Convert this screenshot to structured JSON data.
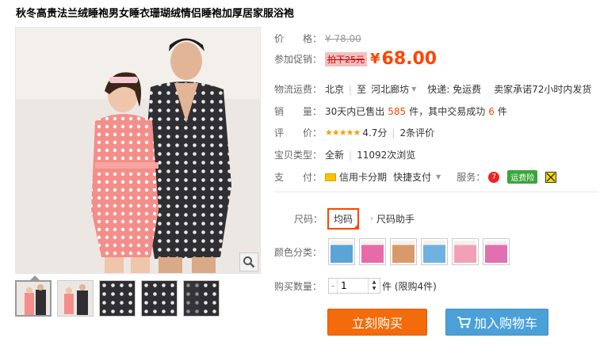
{
  "product": {
    "title": "秋冬高贵法兰绒睡袍男女睡衣珊瑚绒情侣睡袍加厚居家服浴袍"
  },
  "price": {
    "label": "价　　格：",
    "original": "¥ 78.00"
  },
  "promo": {
    "label": "参加促销：",
    "tag": "拍下25元",
    "currency": "¥",
    "amount": "68.00"
  },
  "shipping": {
    "label": "物流运费：",
    "from": "北京",
    "to_prefix": "至",
    "to": "河北廊坊",
    "express": "快递: 免运费",
    "promise": "卖家承诺72小时内发货"
  },
  "sales": {
    "label": "销　　量：",
    "prefix": "30天内已售出",
    "sold": "585",
    "mid": "件，其中交易成功",
    "success": "6",
    "suffix": "件"
  },
  "rating": {
    "label": "评　　价：",
    "stars": "★★★★★",
    "score": "4.7分",
    "reviews": "2条评价"
  },
  "type": {
    "label": "宝贝类型：",
    "condition": "全新",
    "views": "11092次浏览"
  },
  "payment": {
    "label": "支　　付：",
    "credit": "信用卡分期",
    "quick": "快捷支付",
    "service_label": "服务：",
    "service_badge": "7",
    "insurance": "运费险"
  },
  "size": {
    "label": "尺码：",
    "selected": "均码",
    "helper": "尺码助手"
  },
  "colors": {
    "label": "颜色分类：",
    "swatches": [
      "#5aa4d8",
      "#e86aa8",
      "#d89a6a",
      "#6fb2e0",
      "#f2a0b8",
      "#e070b0"
    ]
  },
  "quantity": {
    "label": "购买数量：",
    "minus": "-",
    "value": "1",
    "suffix": "件 (限购4件)"
  },
  "actions": {
    "buy": "立刻购买",
    "cart": "加入购物车"
  },
  "colors_theme": {
    "accent": "#ff4400",
    "buy": "#f46b0b",
    "cart": "#4ba1d7"
  }
}
